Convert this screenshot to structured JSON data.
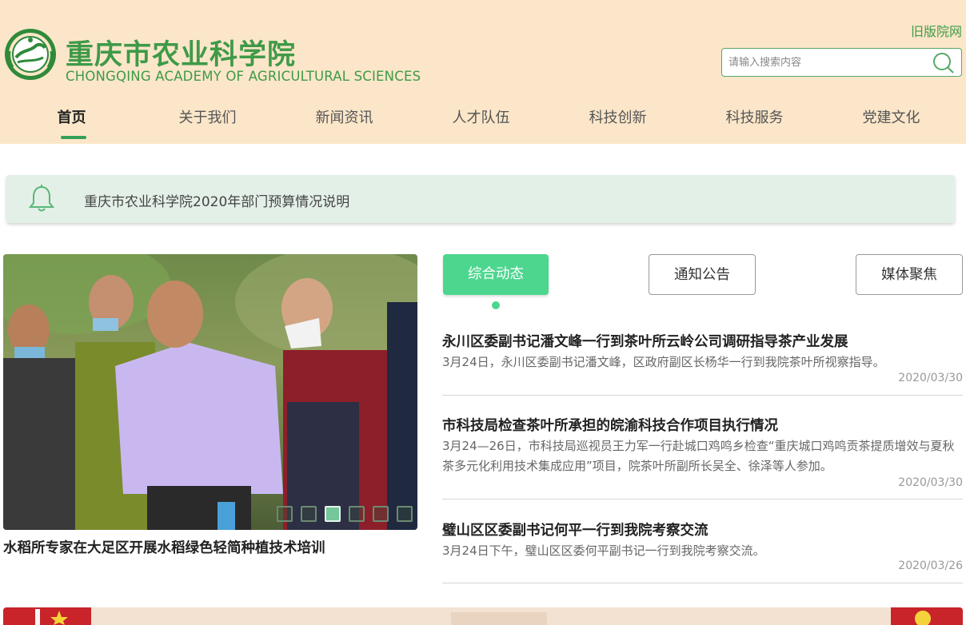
{
  "header": {
    "logo_cn": "重庆市农业科学院",
    "logo_en": "CHONGQING ACADEMY OF AGRICULTURAL SCIENCES",
    "old_site_link": "旧版院网",
    "search_placeholder": "请输入搜索内容"
  },
  "nav": {
    "items": [
      {
        "label": "首页",
        "active": true
      },
      {
        "label": "关于我们"
      },
      {
        "label": "新闻资讯"
      },
      {
        "label": "人才队伍"
      },
      {
        "label": "科技创新"
      },
      {
        "label": "科技服务"
      },
      {
        "label": "党建文化"
      }
    ]
  },
  "notice": {
    "icon": "bell-icon",
    "text": "重庆市农业科学院2020年部门预算情况说明"
  },
  "slideshow": {
    "caption": "水稻所专家在大足区开展水稻绿色轻简种植技术培训",
    "slide_count": 6,
    "active_slide": 3
  },
  "tabs": [
    {
      "label": "综合动态",
      "active": true
    },
    {
      "label": "通知公告"
    },
    {
      "label": "媒体聚焦"
    }
  ],
  "news": [
    {
      "title": "永川区委副书记潘文峰一行到茶叶所云岭公司调研指导茶产业发展",
      "summary": "3月24日，永川区委副书记潘文峰，区政府副区长杨华一行到我院茶叶所视察指导。",
      "date": "2020/03/30"
    },
    {
      "title": "市科技局检查茶叶所承担的皖渝科技合作项目执行情况",
      "summary": "3月24—26日，市科技局巡视员王力军一行赴城口鸡鸣乡检查“重庆城口鸡鸣贡茶提质增效与夏秋茶多元化利用技术集成应用”项目，院茶叶所副所长吴全、徐泽等人参加。",
      "date": "2020/03/30"
    },
    {
      "title": "璧山区区委副书记何平一行到我院考察交流",
      "summary": "3月24日下午，璧山区区委何平副书记一行到我院考察交流。",
      "date": "2020/03/26"
    }
  ],
  "colors": {
    "header_bg": "#fbe6c9",
    "brand_green": "#3f9a48",
    "tab_active": "#4dd68e",
    "notice_bg": "#e3f0e7"
  }
}
